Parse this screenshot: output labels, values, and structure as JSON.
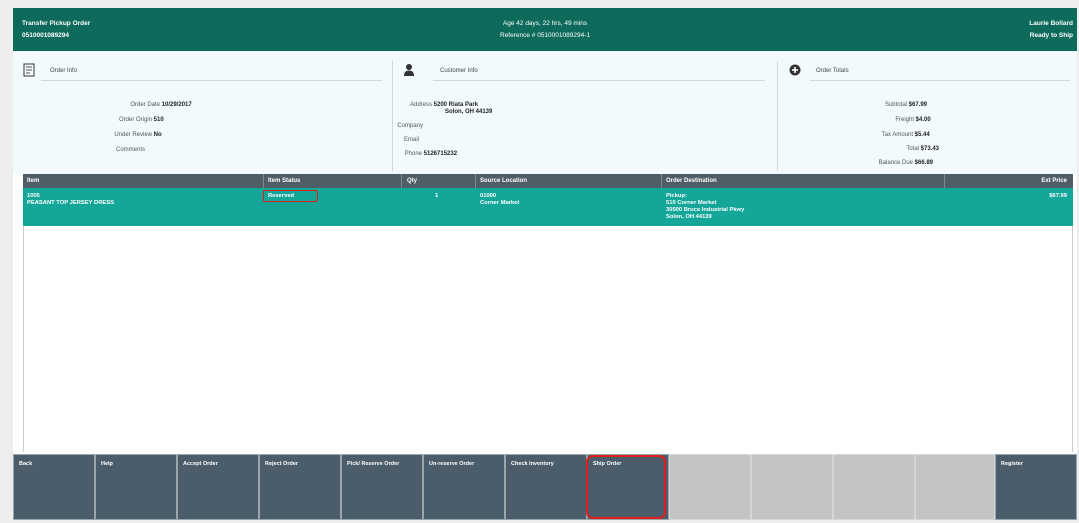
{
  "header": {
    "title": "Transfer Pickup Order",
    "order_number": "0510001089294",
    "age": "Age 42 days, 22 hrs, 49 mins",
    "reference": "Reference # 0510001089294-1",
    "user": "Laurie Bollard",
    "status": "Ready to Ship"
  },
  "order_info": {
    "title": "Order Info",
    "order_date_label": "Order Date",
    "order_date": "10/29/2017",
    "order_origin_label": "Order Origin",
    "order_origin": "510",
    "under_review_label": "Under Review",
    "under_review": "No",
    "comments_label": "Comments"
  },
  "customer_info": {
    "title": "Customer Info",
    "address_label": "Address",
    "address_line1": "5200 Riata Park",
    "address_line2": "Solon, OH 44139",
    "company_label": "Company",
    "email_label": "Email",
    "phone_label": "Phone",
    "phone": "5126715232"
  },
  "order_totals": {
    "title": "Order Totals",
    "subtotal_label": "Subtotal",
    "subtotal": "$67.99",
    "freight_label": "Freight",
    "freight": "$4.00",
    "tax_label": "Tax Amount",
    "tax": "$5.44",
    "total_label": "Total",
    "total": "$73.43",
    "balance_label": "Balance Due",
    "balance": "$66.89"
  },
  "table": {
    "headers": {
      "item": "Item",
      "item_status": "Item Status",
      "qty": "Qty",
      "source_location": "Source Location",
      "order_destination": "Order Destination",
      "ext_price": "Ext Price"
    },
    "rows": [
      {
        "item_id": "1005",
        "item_name": "PEASANT TOP JERSEY DRESS",
        "status": "Reserved",
        "qty": "1",
        "source_id": "01000",
        "source_name": "Corner Market",
        "dest_type": "Pickup:",
        "dest_store": "510 Corner Market",
        "dest_addr1": "30500 Bruce Industrial Pkwy",
        "dest_addr2": "Solon, OH 44139",
        "ext_price": "$67.99"
      }
    ]
  },
  "toolbar": {
    "back": "Back",
    "help": "Help",
    "accept_order": "Accept Order",
    "reject_order": "Reject Order",
    "pick_reserve_order": "Pick/ Reserve Order",
    "unreserve_order": "Un-reserve Order",
    "check_inventory": "Check Inventory",
    "ship_order": "Ship Order",
    "register": "Register"
  },
  "colors": {
    "header_bg": "#0e6a5a",
    "row_selected": "#14a699",
    "table_header": "#4f5d66",
    "button": "#4b5d6a",
    "highlight": "#e01d1d"
  }
}
